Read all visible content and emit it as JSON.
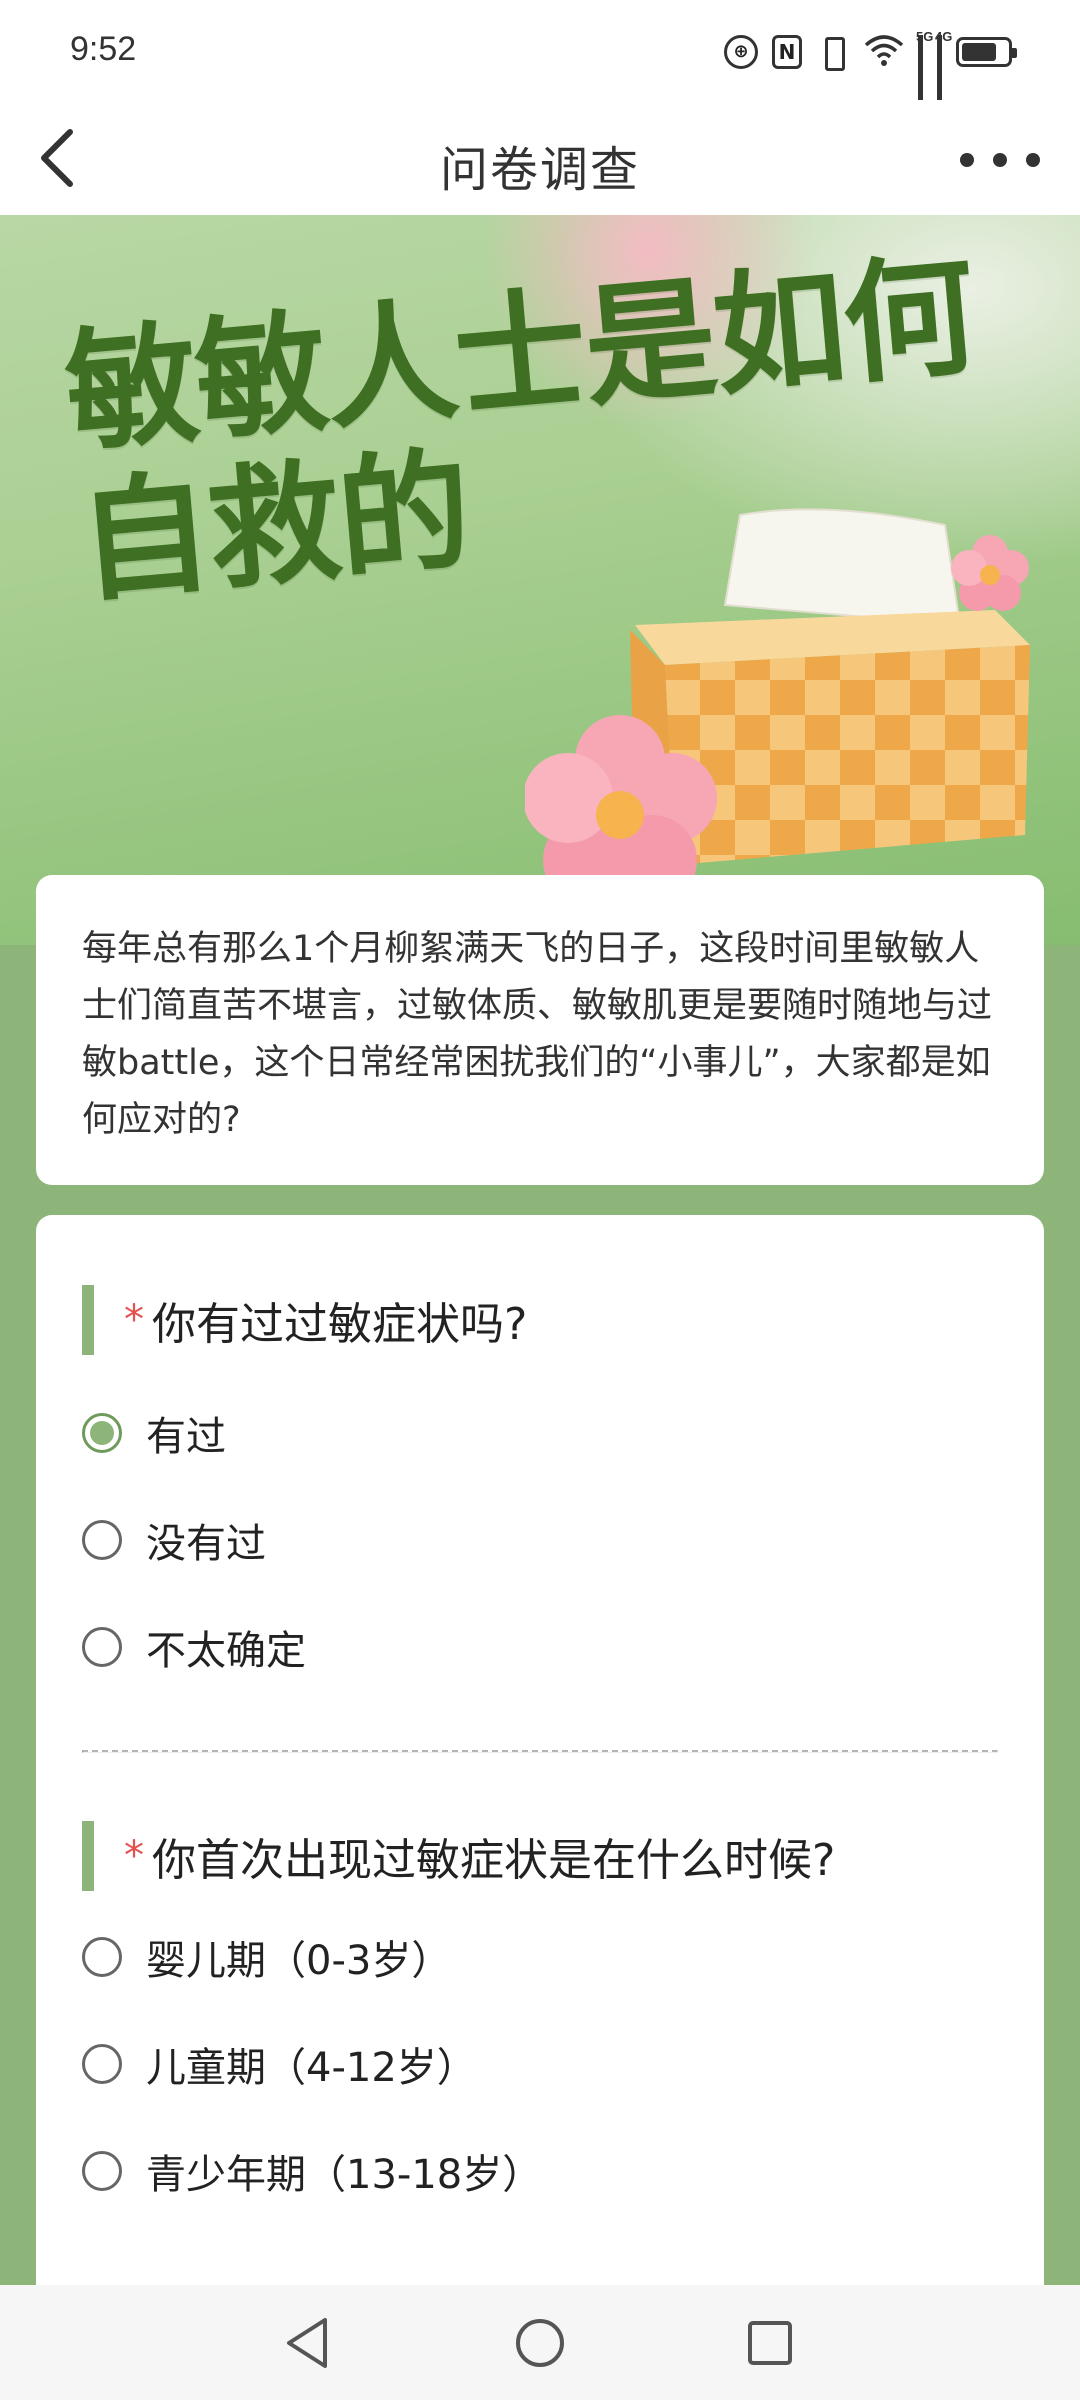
{
  "status_bar": {
    "time": "9:52",
    "icons": [
      "hd-icon",
      "nfc-icon",
      "vibrate-icon",
      "wifi-icon",
      "signal-5g-icon",
      "signal-4g-icon",
      "battery-icon"
    ],
    "signal_labels": [
      "5G",
      "4G"
    ],
    "nfc_label": "N"
  },
  "header": {
    "title": "问卷调查",
    "back_icon": "chevron-left-icon",
    "more_icon": "more-horizontal-icon"
  },
  "banner": {
    "title_line1": "敏敏人士是如何",
    "title_line2": "自救的",
    "colors": {
      "title": "#3f6f22",
      "background": "#a9cf92",
      "tissue_box": "#f0b65a",
      "flower": "#f7a6b4"
    }
  },
  "intro": {
    "text": "每年总有那么1个月柳絮满天飞的日子，这段时间里敏敏人士们简直苦不堪言，过敏体质、敏敏肌更是要随时随地与过敏battle，这个日常经常困扰我们的“小事儿”，大家都是如何应对的?"
  },
  "questions": [
    {
      "required_mark": "*",
      "title": "你有过过敏症状吗?",
      "options": [
        {
          "label": "有过",
          "checked": true
        },
        {
          "label": "没有过",
          "checked": false
        },
        {
          "label": "不太确定",
          "checked": false
        }
      ]
    },
    {
      "required_mark": "*",
      "title": "你首次出现过敏症状是在什么时候?",
      "options": [
        {
          "label": "婴儿期（0-3岁）",
          "checked": false
        },
        {
          "label": "儿童期（4-12岁）",
          "checked": false
        },
        {
          "label": "青少年期（13-18岁）",
          "checked": false
        }
      ]
    }
  ],
  "nav_bar": {
    "buttons": [
      "back-triangle-icon",
      "home-circle-icon",
      "recents-square-icon"
    ]
  },
  "theme": {
    "accent": "#8db579",
    "required": "#e25050",
    "page_background": "#8db579"
  }
}
